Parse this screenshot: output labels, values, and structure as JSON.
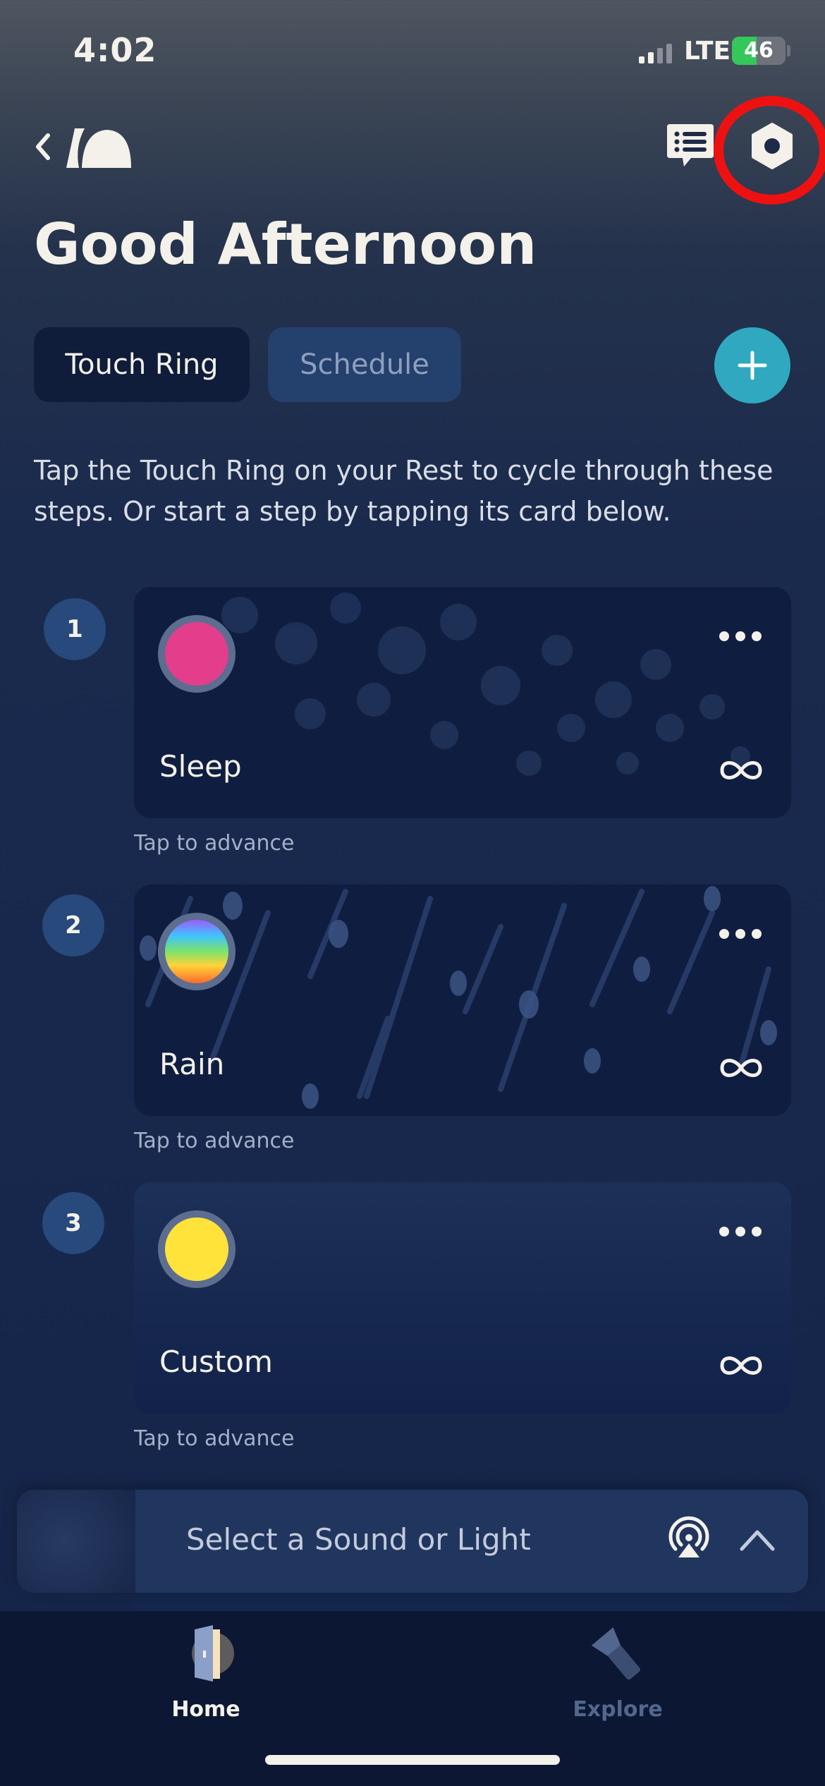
{
  "status_bar": {
    "time": "4:02",
    "network": "LTE",
    "battery": "46",
    "battery_level": 0.46
  },
  "nav": {
    "back_icon": "chevron-left-icon",
    "logo": "hatch-logo",
    "chat_icon": "chat-list-icon",
    "settings_icon": "settings-hex-icon",
    "highlight_color": "#ee1111"
  },
  "header": {
    "greeting": "Good Afternoon"
  },
  "tabs": [
    {
      "label": "Touch Ring",
      "active": true
    },
    {
      "label": "Schedule",
      "active": false
    }
  ],
  "add_button": {
    "icon": "plus-icon",
    "color": "#2fa8c0"
  },
  "intro_text": "Tap the Touch Ring on your Rest to cycle through these steps. Or start a step by tapping its card below.",
  "steps": [
    {
      "number": "1",
      "label": "Sleep",
      "color": "#e23e8c",
      "hint": "Tap to advance",
      "duration_icon": "infinity-icon"
    },
    {
      "number": "2",
      "label": "Rain",
      "color": "rainbow",
      "hint": "Tap to advance",
      "duration_icon": "infinity-icon"
    },
    {
      "number": "3",
      "label": "Custom",
      "color": "#ffe33b",
      "hint": "Tap to advance",
      "duration_icon": "infinity-icon"
    }
  ],
  "player": {
    "text": "Select a Sound or Light",
    "airplay_icon": "airplay-icon",
    "expand_icon": "chevron-up-icon"
  },
  "tab_bar": [
    {
      "label": "Home",
      "icon": "door-icon",
      "active": true
    },
    {
      "label": "Explore",
      "icon": "flashlight-icon",
      "active": false
    }
  ]
}
